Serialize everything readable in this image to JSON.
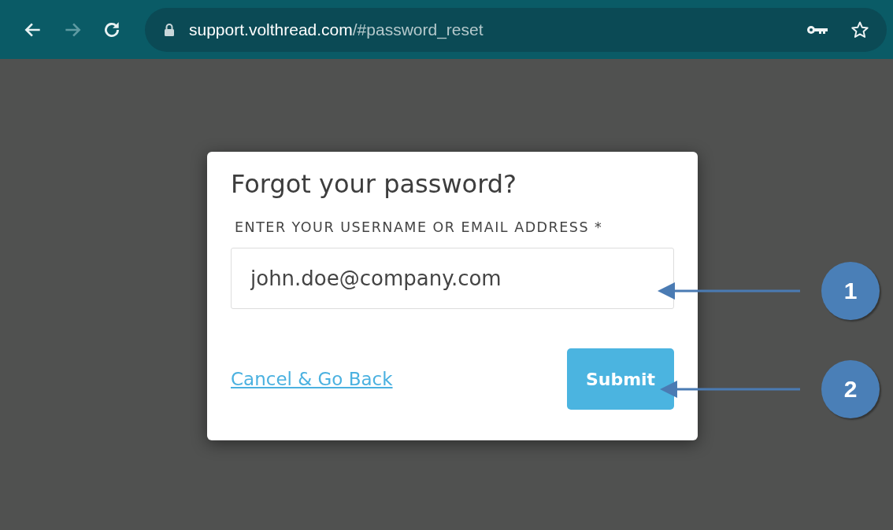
{
  "browser": {
    "nav": [
      {
        "kind": "back",
        "disabled": false
      },
      {
        "kind": "forward",
        "disabled": true
      },
      {
        "kind": "reload",
        "disabled": false
      }
    ],
    "url": {
      "host": "support.volthread.com",
      "path": "/#password_reset"
    }
  },
  "dialog": {
    "title": "Forgot your password?",
    "field_label": "ENTER YOUR USERNAME OR EMAIL ADDRESS *",
    "field_value": "john.doe@company.com",
    "cancel_link": "Cancel & Go Back",
    "submit_button": "Submit"
  },
  "callouts": [
    {
      "number": "1"
    },
    {
      "number": "2"
    }
  ]
}
